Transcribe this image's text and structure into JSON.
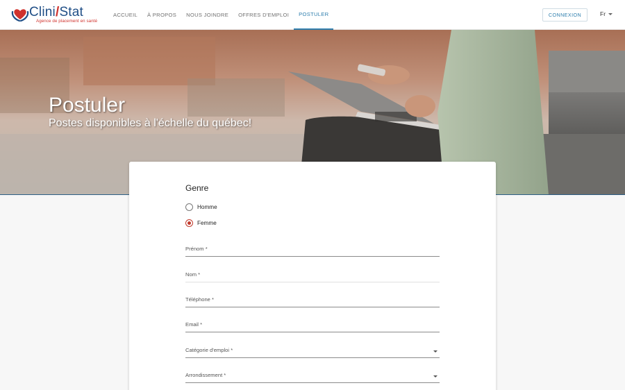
{
  "brand": {
    "name_part1": "Clini",
    "name_sep": "/",
    "name_part2": "Stat",
    "tagline": "Agence de placement en santé",
    "primary_color": "#1f4e86",
    "accent_color": "#d0322d"
  },
  "nav": {
    "items": [
      {
        "label": "ACCUEIL",
        "active": false
      },
      {
        "label": "À PROPOS",
        "active": false
      },
      {
        "label": "NOUS JOINDRE",
        "active": false
      },
      {
        "label": "OFFRES D'EMPLOI",
        "active": false
      },
      {
        "label": "POSTULER",
        "active": true
      }
    ],
    "login_label": "CONNEXION",
    "language": "Fr",
    "active_color": "#2f7fae"
  },
  "hero": {
    "title": "Postuler",
    "subtitle": "Postes disponibles à l'échelle du québec!"
  },
  "form": {
    "genre_label": "Genre",
    "radios": [
      {
        "label": "Homme",
        "checked": false
      },
      {
        "label": "Femme",
        "checked": true
      }
    ],
    "fields": [
      {
        "label": "Prénom *",
        "type": "text"
      },
      {
        "label": "Nom *",
        "type": "text"
      },
      {
        "label": "Téléphone *",
        "type": "text"
      },
      {
        "label": "Email *",
        "type": "text"
      },
      {
        "label": "Catégorie d'emploi *",
        "type": "select"
      },
      {
        "label": "Arrondissement *",
        "type": "select"
      }
    ],
    "icons": {
      "select": "chevron-down-icon",
      "radio_checked": "radio-checked-icon"
    }
  }
}
